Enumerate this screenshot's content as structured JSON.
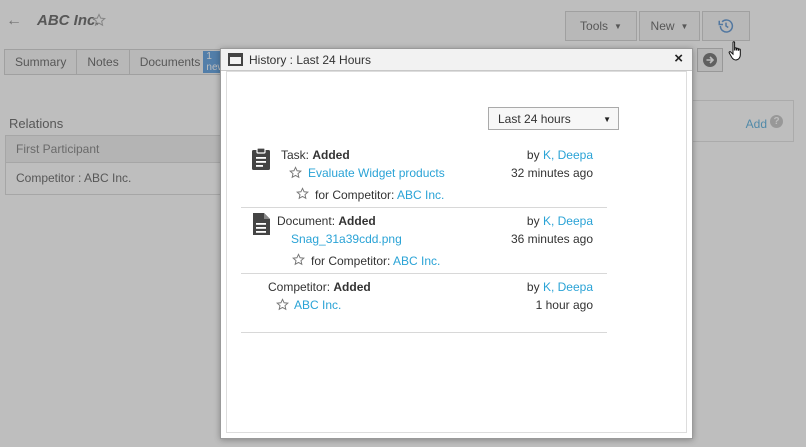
{
  "page": {
    "back_icon": "arrow-left-icon",
    "title": "ABC Inc.",
    "tools_label": "Tools",
    "new_label": "New",
    "history_icon": "history-icon",
    "tabs": [
      {
        "label": "Summary"
      },
      {
        "label": "Notes"
      },
      {
        "label": "Documents",
        "badge": "1 new"
      }
    ],
    "relations_label": "Relations",
    "relations_header": "First Participant",
    "relations_row": "Competitor : ABC Inc.",
    "side_add_label": "Add",
    "side_help": "?"
  },
  "dialog": {
    "title": "History : Last 24 Hours",
    "close_label": "×",
    "filter": {
      "selected": "Last 24 hours"
    },
    "entries": [
      {
        "icon": "task-clipboard-icon",
        "type_label": "Task:",
        "action": "Added",
        "item": "Evaluate Widget products",
        "for_label": "for Competitor:",
        "for_value": "ABC Inc.",
        "by_label": "by",
        "author": "K, Deepa",
        "time": "32 minutes ago"
      },
      {
        "icon": "document-icon",
        "type_label": "Document:",
        "action": "Added",
        "item": "Snag_31a39cdd.png",
        "for_label": "for Competitor:",
        "for_value": "ABC Inc.",
        "by_label": "by",
        "author": "K, Deepa",
        "time": "36 minutes ago"
      },
      {
        "type_label": "Competitor:",
        "action": "Added",
        "item": "ABC Inc.",
        "by_label": "by",
        "author": "K, Deepa",
        "time": "1 hour ago"
      }
    ]
  },
  "colors": {
    "link": "#2aa3d6",
    "overlay": "#6e6e6e",
    "badge": "#3b8ad9"
  }
}
